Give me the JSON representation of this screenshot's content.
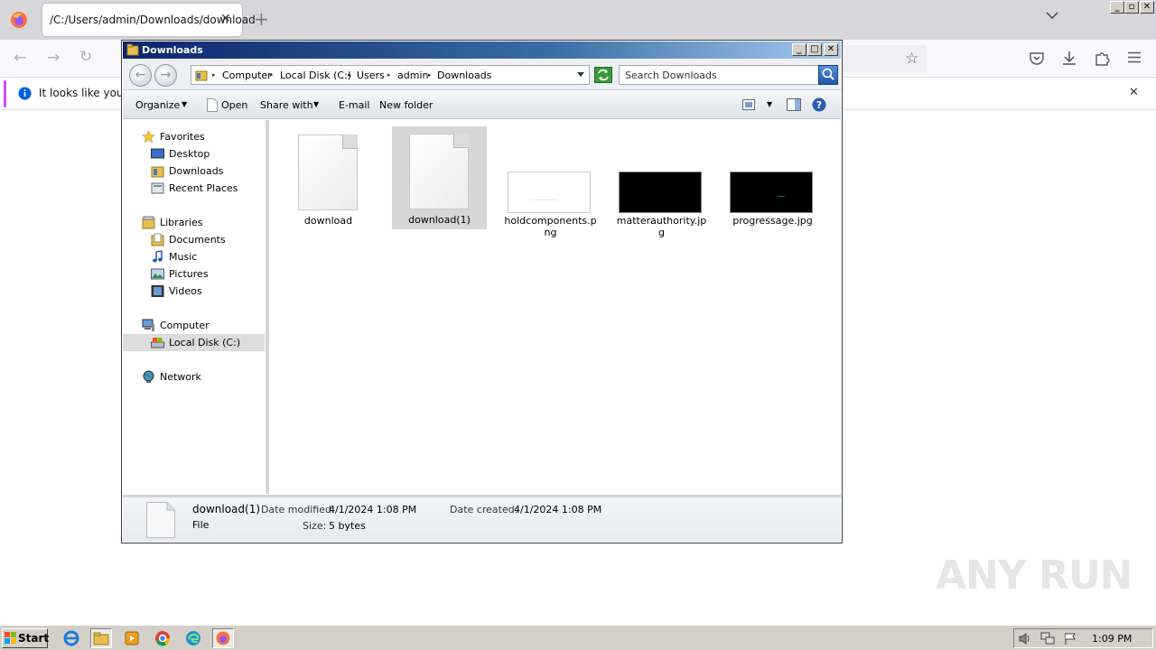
{
  "browser": {
    "tab_title": "/C:/Users/admin/Downloads/download",
    "tab_close": "✕",
    "new_tab": "+",
    "notification_text": "It looks like you ha",
    "notification_close": "✕"
  },
  "window": {
    "title": "Downloads",
    "breadcrumbs": [
      "Computer",
      "Local Disk (C:)",
      "Users",
      "admin",
      "Downloads"
    ],
    "search_placeholder": "Search Downloads"
  },
  "toolbar": {
    "organize": "Organize",
    "open": "Open",
    "share_with": "Share with",
    "email": "E-mail",
    "new_folder": "New folder"
  },
  "nav": {
    "favorites": "Favorites",
    "desktop": "Desktop",
    "downloads": "Downloads",
    "recent_places": "Recent Places",
    "libraries": "Libraries",
    "documents": "Documents",
    "music": "Music",
    "pictures": "Pictures",
    "videos": "Videos",
    "computer": "Computer",
    "local_disk": "Local Disk (C:)",
    "network": "Network"
  },
  "files": [
    {
      "name": "download",
      "kind": "doc"
    },
    {
      "name": "download(1)",
      "kind": "doc",
      "selected": true
    },
    {
      "name": "holdcomponents.png",
      "kind": "thumb-white"
    },
    {
      "name": "matterauthority.jpg",
      "kind": "thumb-black"
    },
    {
      "name": "progressage.jpg",
      "kind": "thumb-black"
    }
  ],
  "details": {
    "name": "download(1)",
    "type": "File",
    "date_modified_label": "Date modified:",
    "date_modified": "4/1/2024 1:08 PM",
    "size_label": "Size:",
    "size": "5 bytes",
    "date_created_label": "Date created:",
    "date_created": "4/1/2024 1:08 PM"
  },
  "taskbar": {
    "start": "Start",
    "clock": "1:09 PM"
  },
  "watermark": "ANY RUN"
}
